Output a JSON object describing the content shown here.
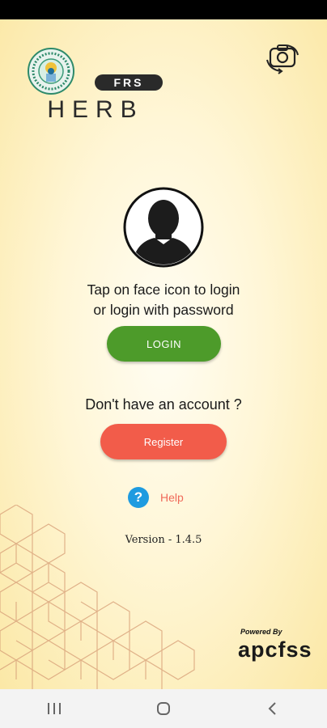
{
  "header": {
    "badge_text": "FRS",
    "brand_text": "HERB"
  },
  "login": {
    "prompt_line1": "Tap on face icon to login",
    "prompt_line2": "or login with password",
    "login_label": "LOGIN"
  },
  "register": {
    "question": "Don't have an account ?",
    "register_label": "Register"
  },
  "help": {
    "icon_glyph": "?",
    "label": "Help"
  },
  "version_text": "Version - 1.4.5",
  "footer": {
    "powered_by": "Powered By",
    "brand": "apcfss"
  },
  "icons": {
    "camera_switch": "camera-switch-icon",
    "face": "user-silhouette-icon",
    "emblem": "state-emblem-icon"
  },
  "colors": {
    "login_button": "#4d9b2a",
    "register_button": "#f25c4a",
    "help_icon": "#1e9be0",
    "help_text": "#f06a5a"
  }
}
